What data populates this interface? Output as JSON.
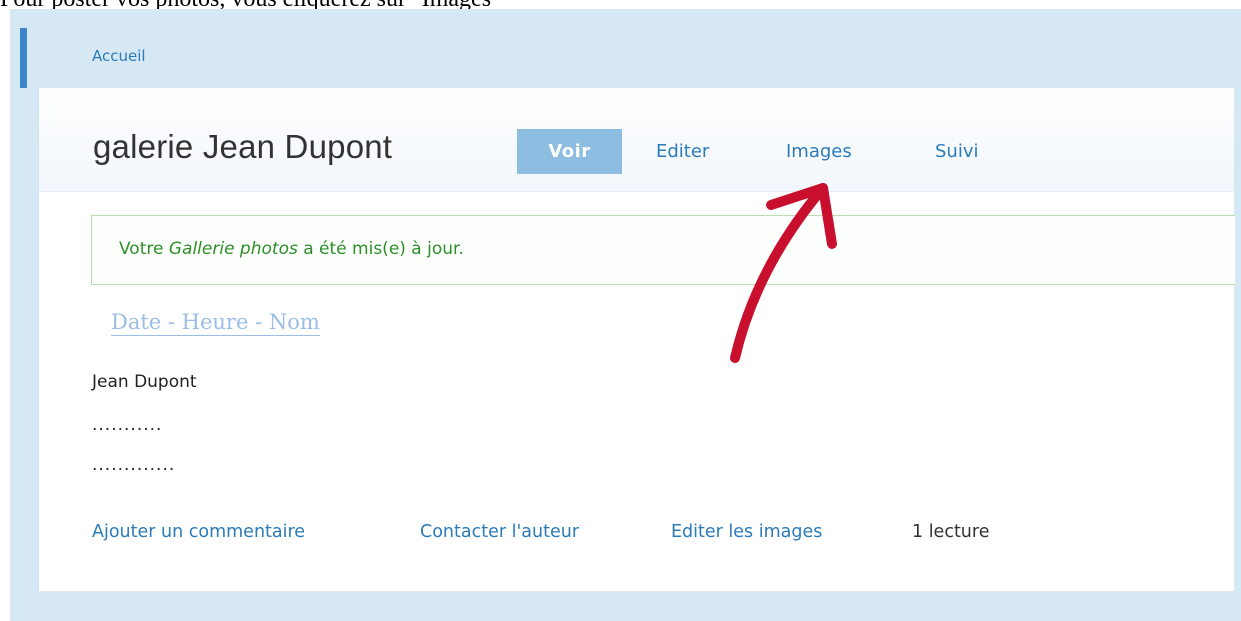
{
  "caption": "Pour poster vos photos, vous cliquerez sur \"Images\"",
  "breadcrumb": {
    "home": "Accueil"
  },
  "page": {
    "title": "galerie Jean Dupont"
  },
  "tabs": [
    {
      "label": "Voir",
      "active": true
    },
    {
      "label": "Editer",
      "active": false
    },
    {
      "label": "Images",
      "active": false
    },
    {
      "label": "Suivi",
      "active": false
    }
  ],
  "status": {
    "prefix": "Votre ",
    "emphasis": "Gallerie photos",
    "suffix": " a été mis(e) à jour."
  },
  "sort_link": "Date - Heure - Nom",
  "content": {
    "author": "Jean Dupont",
    "line1": "...........",
    "line2": "............."
  },
  "links": {
    "add_comment": "Ajouter un commentaire",
    "contact_author": "Contacter l'auteur",
    "edit_images": "Editer les images",
    "reads": "1 lecture"
  },
  "colors": {
    "accent": "#3a86c9",
    "link": "#2b7bb9",
    "active_tab": "#8dbde0",
    "status_green": "#2e8f2a",
    "arrow_red": "#c8102e"
  }
}
